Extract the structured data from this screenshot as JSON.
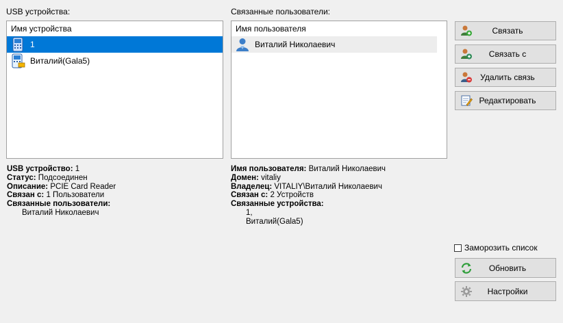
{
  "usb_panel": {
    "title": "USB устройства:",
    "column_header": "Имя устройства",
    "items": [
      {
        "label": "1",
        "selected": true
      },
      {
        "label": "Виталий(Gala5)",
        "selected": false
      }
    ]
  },
  "users_panel": {
    "title": "Связанные пользователи:",
    "column_header": "Имя пользователя",
    "items": [
      {
        "label": "Виталий Николаевич"
      }
    ]
  },
  "actions": {
    "link": "Связать",
    "link_with": "Связать с",
    "unlink": "Удалить связь",
    "edit": "Редактировать"
  },
  "device_info": {
    "usb_device_label": "USB устройство:",
    "usb_device_value": "1",
    "status_label": "Статус:",
    "status_value": "Подсоединен",
    "description_label": "Описание:",
    "description_value": "PCIE Card Reader",
    "linked_with_label": "Связан с:",
    "linked_with_value": "1 Пользователи",
    "linked_users_label": "Связанные пользователи:",
    "linked_users": [
      "Виталий Николаевич"
    ]
  },
  "user_info": {
    "username_label": "Имя пользователя:",
    "username_value": "Виталий Николаевич",
    "domain_label": "Домен:",
    "domain_value": "vitaliy",
    "owner_label": "Владелец:",
    "owner_value": "VITALIY\\Виталий Николаевич",
    "linked_with_label": "Связан с:",
    "linked_with_value": "2 Устройств",
    "linked_devices_label": "Связанные устройства:",
    "linked_devices": [
      "1,",
      "Виталий(Gala5)"
    ]
  },
  "freeze_list": {
    "label": "Заморозить список",
    "checked": false
  },
  "bottom_buttons": {
    "refresh": "Обновить",
    "settings": "Настройки"
  },
  "icons": {
    "link": "user-link-icon",
    "link_with": "user-link-with-icon",
    "unlink": "user-unlink-icon",
    "edit": "edit-icon",
    "refresh": "refresh-icon",
    "settings": "gear-icon",
    "usb_device": "usb-device-icon",
    "usb_device_gala": "usb-device-gala-icon",
    "user": "user-icon"
  }
}
